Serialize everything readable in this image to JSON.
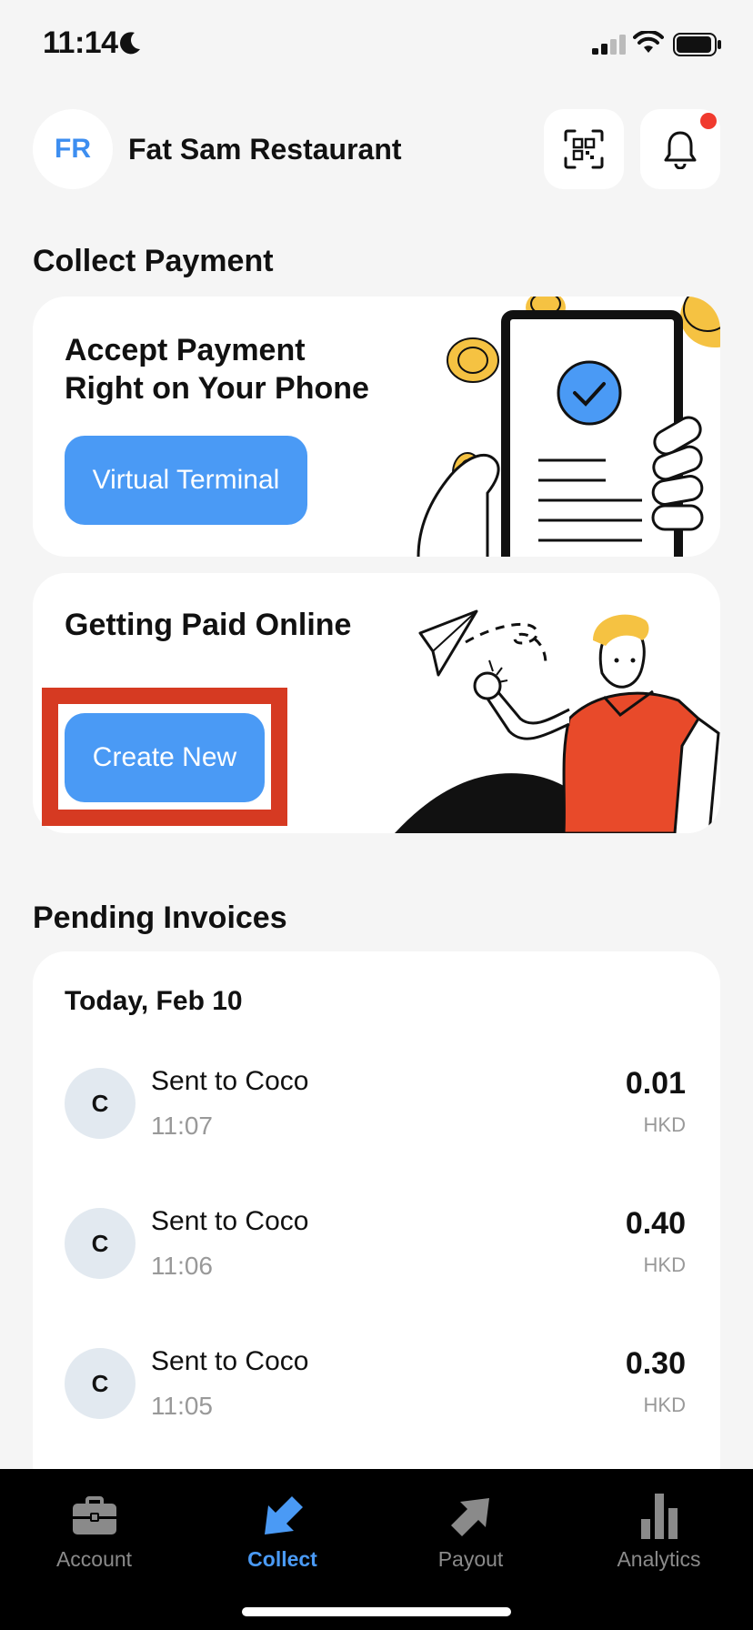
{
  "status_bar": {
    "time": "11:14"
  },
  "header": {
    "avatar_initials": "FR",
    "merchant_name": "Fat Sam Restaurant"
  },
  "collect": {
    "section_title": "Collect Payment",
    "accept_card": {
      "heading_line1": "Accept Payment",
      "heading_line2": "Right on Your Phone",
      "button_label": "Virtual Terminal"
    },
    "online_card": {
      "heading": "Getting Paid Online",
      "button_label": "Create New"
    }
  },
  "pending": {
    "section_title": "Pending Invoices",
    "date_header": "Today, Feb 10",
    "invoices": [
      {
        "initial": "C",
        "title": "Sent to Coco",
        "time": "11:07",
        "amount": "0.01",
        "currency": "HKD"
      },
      {
        "initial": "C",
        "title": "Sent to Coco",
        "time": "11:06",
        "amount": "0.40",
        "currency": "HKD"
      },
      {
        "initial": "C",
        "title": "Sent to Coco",
        "time": "11:05",
        "amount": "0.30",
        "currency": "HKD"
      }
    ]
  },
  "tabs": [
    {
      "label": "Account",
      "icon": "briefcase-icon",
      "active": false
    },
    {
      "label": "Collect",
      "icon": "arrow-down-left-icon",
      "active": true
    },
    {
      "label": "Payout",
      "icon": "arrow-up-right-icon",
      "active": false
    },
    {
      "label": "Analytics",
      "icon": "bar-chart-icon",
      "active": false
    }
  ],
  "colors": {
    "accent": "#4a9af5",
    "highlight": "#d63a22",
    "notification": "#f03a2e",
    "coin": "#f5c242",
    "shirt": "#e84a2a"
  }
}
